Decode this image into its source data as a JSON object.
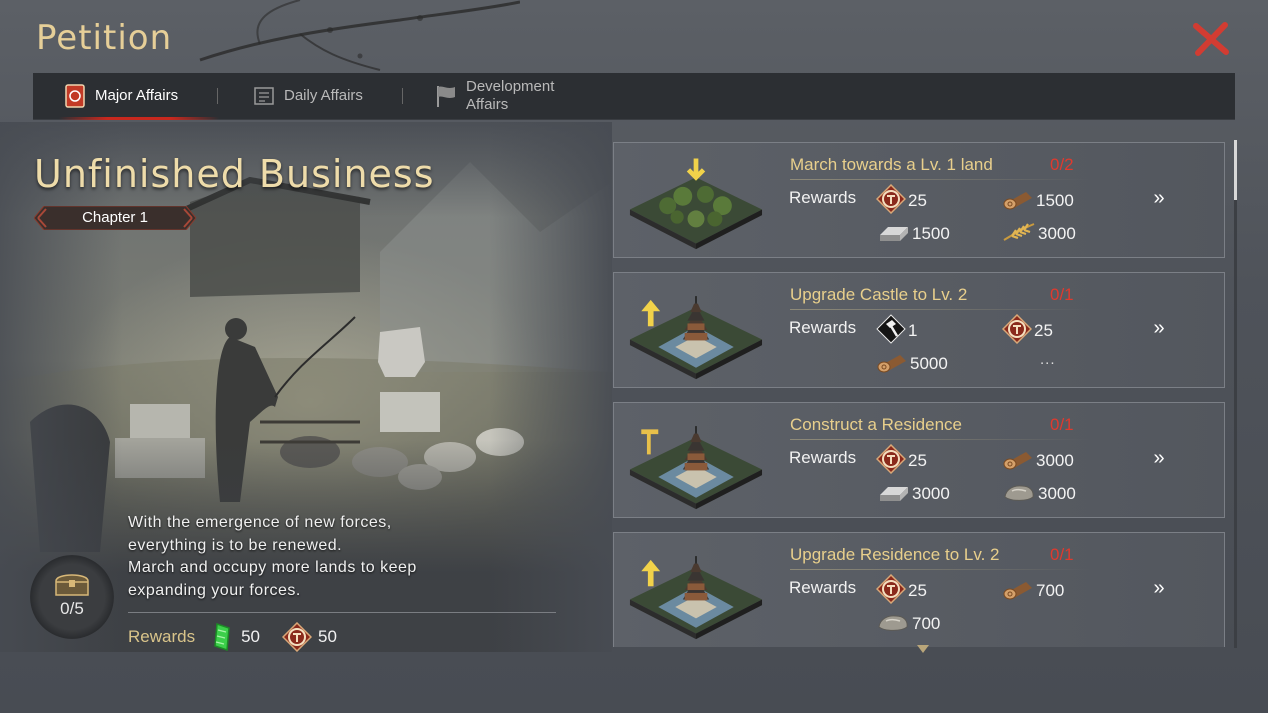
{
  "header": {
    "title": "Petition"
  },
  "tabs": [
    {
      "label": "Major Affairs",
      "active": true
    },
    {
      "label": "Daily Affairs",
      "active": false
    },
    {
      "label": "Development Affairs",
      "active": false
    }
  ],
  "chapter": {
    "title": "Unfinished Business",
    "chapter_label": "Chapter 1",
    "description": [
      "With the emergence of new forces,",
      "everything is to be renewed.",
      "March and occupy more lands to keep",
      "expanding your forces."
    ],
    "rewards_label": "Rewards",
    "rewards": [
      {
        "icon": "jade-icon",
        "value": "50"
      },
      {
        "icon": "seal-token-icon",
        "value": "50"
      }
    ],
    "chest_progress": "0/5"
  },
  "tasks": [
    {
      "name": "March towards a Lv. 1 land",
      "progress": "0/2",
      "thumb": "land-thumb",
      "rewards_label": "Rewards",
      "rewards": [
        {
          "icon": "seal-token-icon",
          "value": "25"
        },
        {
          "icon": "wood-icon",
          "value": "1500"
        },
        {
          "icon": "iron-icon",
          "value": "1500"
        },
        {
          "icon": "grain-icon",
          "value": "3000"
        }
      ],
      "more": ""
    },
    {
      "name": "Upgrade Castle to Lv. 2",
      "progress": "0/1",
      "thumb": "castle-thumb",
      "rewards_label": "Rewards",
      "rewards": [
        {
          "icon": "hammer-icon",
          "value": "1"
        },
        {
          "icon": "seal-token-icon",
          "value": "25"
        },
        {
          "icon": "wood-icon",
          "value": "5000"
        }
      ],
      "more": "..."
    },
    {
      "name": "Construct a Residence",
      "progress": "0/1",
      "thumb": "residence-thumb",
      "rewards_label": "Rewards",
      "rewards": [
        {
          "icon": "seal-token-icon",
          "value": "25"
        },
        {
          "icon": "wood-icon",
          "value": "3000"
        },
        {
          "icon": "iron-icon",
          "value": "3000"
        },
        {
          "icon": "stone-icon",
          "value": "3000"
        }
      ],
      "more": ""
    },
    {
      "name": "Upgrade Residence to Lv. 2",
      "progress": "0/1",
      "thumb": "castle-thumb",
      "rewards_label": "Rewards",
      "rewards": [
        {
          "icon": "seal-token-icon",
          "value": "25"
        },
        {
          "icon": "wood-icon",
          "value": "700"
        },
        {
          "icon": "stone-icon",
          "value": "700"
        }
      ],
      "more": ""
    }
  ],
  "go_label": "»",
  "colors": {
    "accent_gold": "#e8cf8c",
    "progress_red": "#e03a2e",
    "close_red": "#d23c32"
  }
}
